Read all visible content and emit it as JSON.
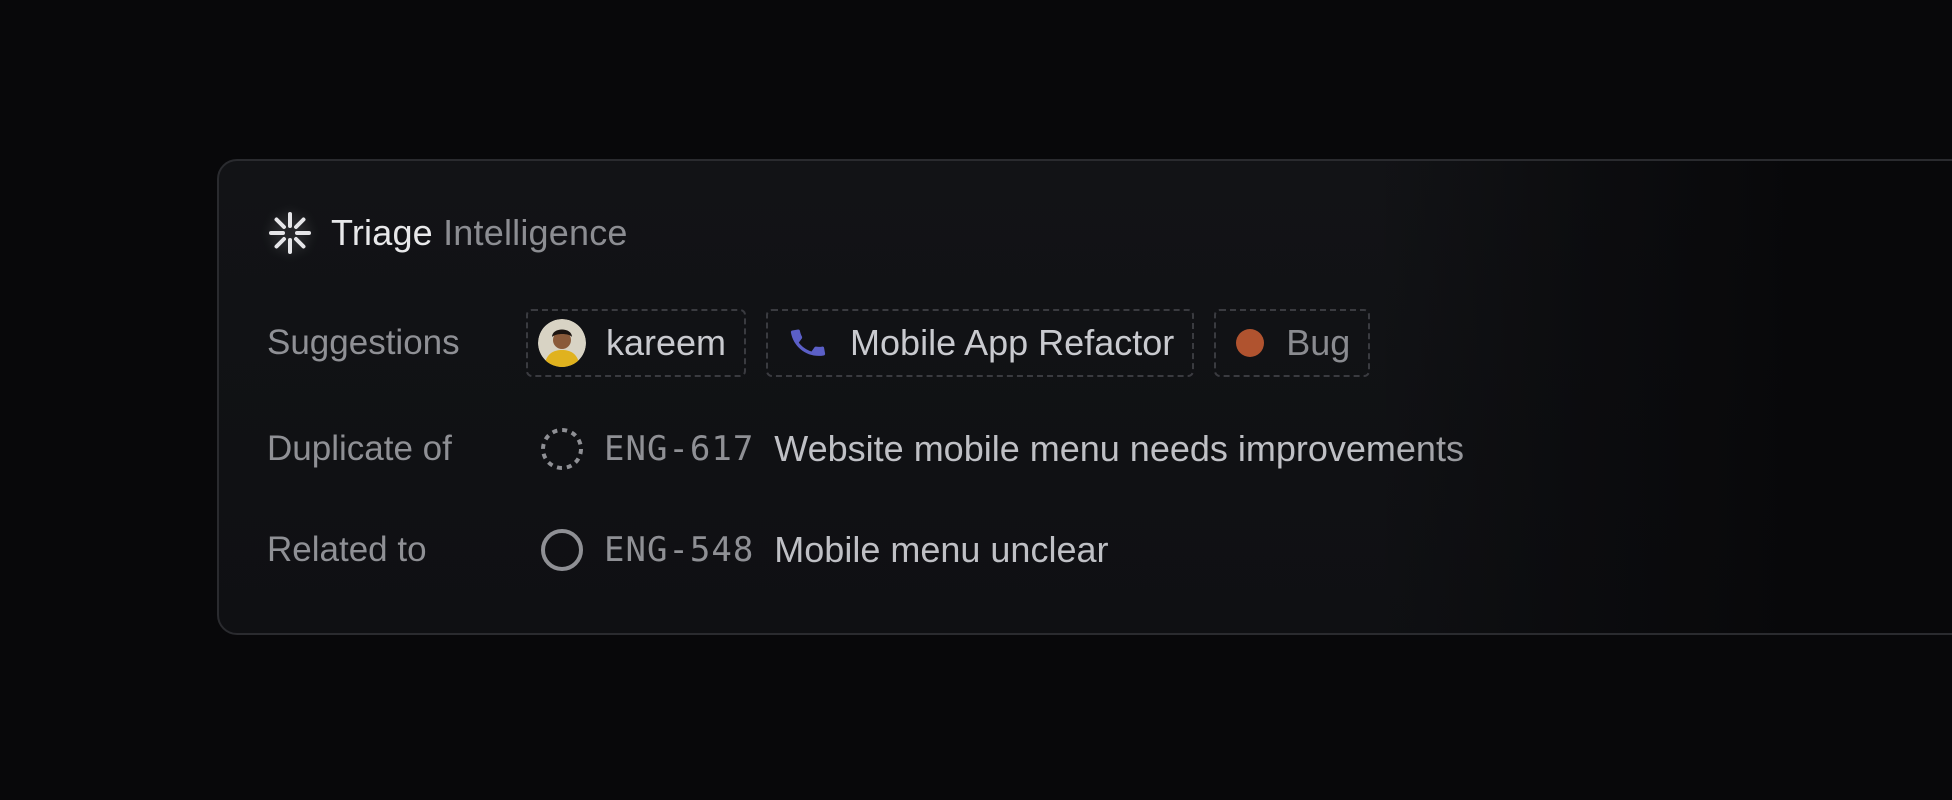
{
  "header": {
    "title_part1": "Triage ",
    "title_part2": "Intelligence",
    "icon": "sparkle-icon"
  },
  "suggestions": {
    "label": "Suggestions",
    "assignee": {
      "name": "kareem",
      "icon": "avatar"
    },
    "project": {
      "name": "Mobile App Refactor",
      "icon": "phone-icon",
      "color": "#5b5fc7"
    },
    "label_chip": {
      "name": "Bug",
      "icon": "dot-icon",
      "color": "#b0532f"
    }
  },
  "duplicate": {
    "label": "Duplicate of",
    "id": "ENG-617",
    "title": "Website mobile menu needs improvements",
    "status_icon": "backlog-status-icon"
  },
  "related": {
    "label": "Related to",
    "id": "ENG-548",
    "title": "Mobile menu unclear",
    "status_icon": "todo-status-icon"
  }
}
